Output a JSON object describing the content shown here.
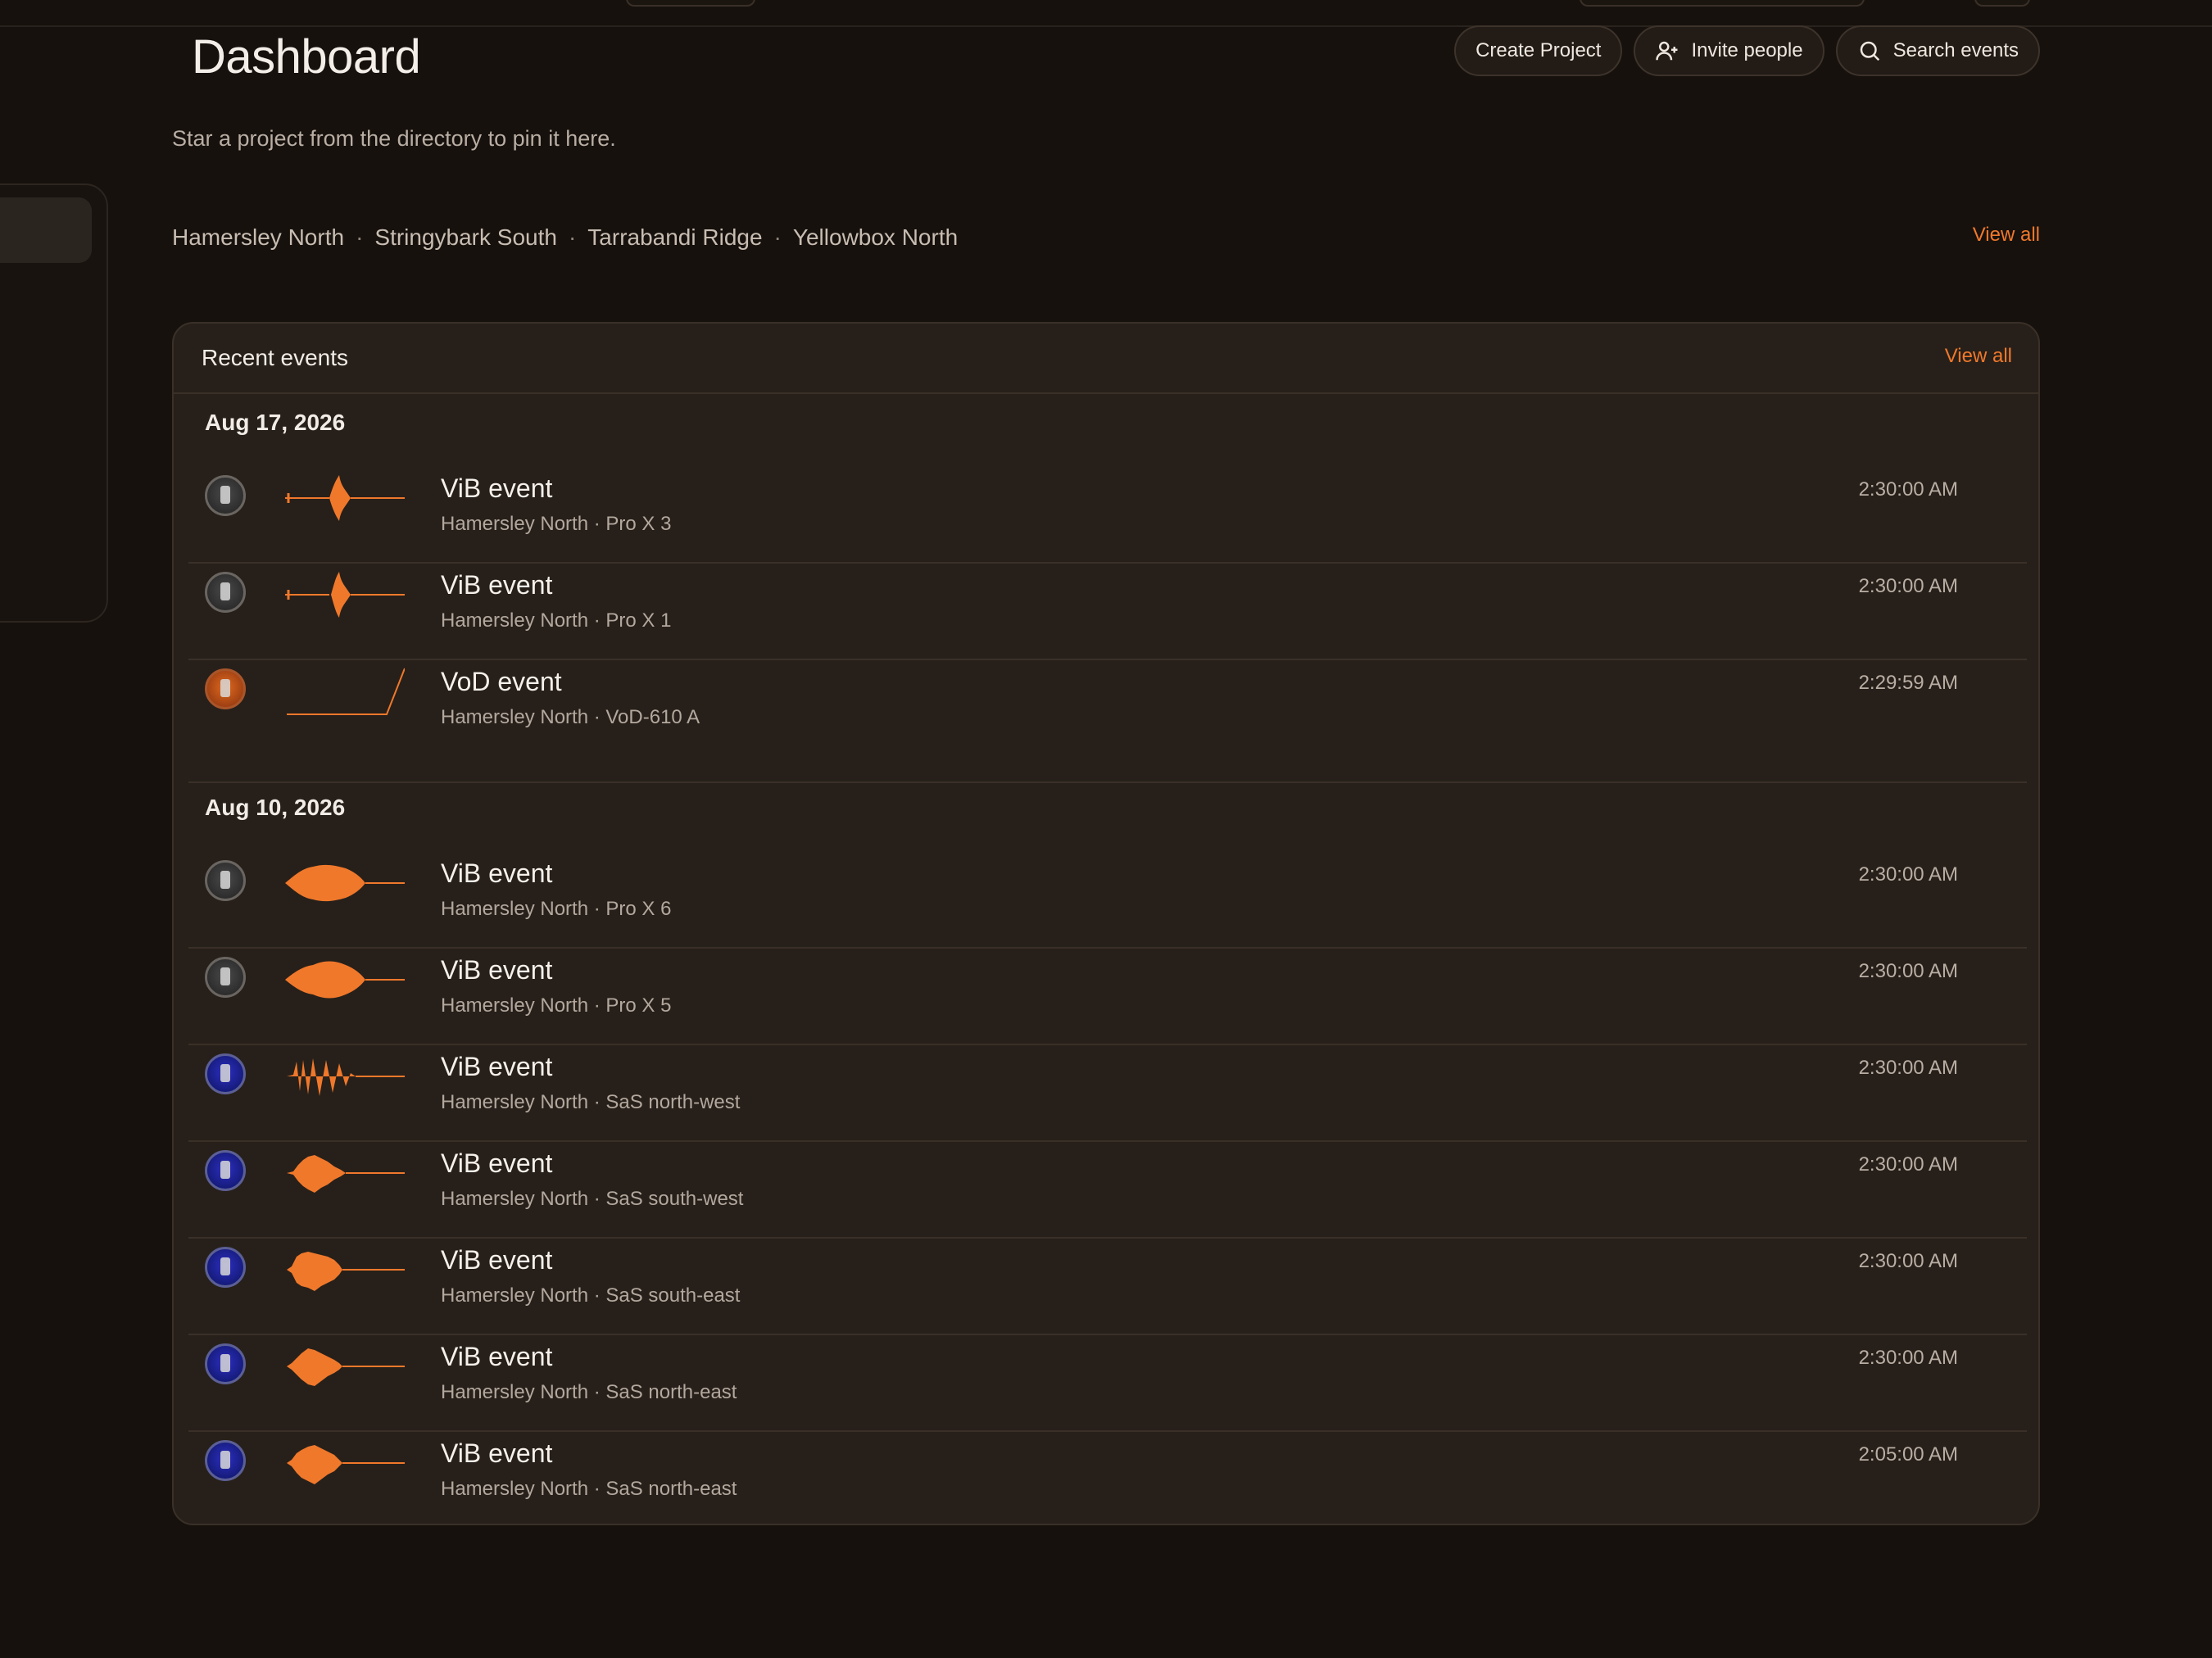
{
  "header": {
    "title": "Dashboard",
    "actions": [
      {
        "label": "Create Project",
        "icon": "none"
      },
      {
        "label": "Invite people",
        "icon": "user-plus-icon"
      },
      {
        "label": "Search events",
        "icon": "search-icon"
      }
    ]
  },
  "pinned": {
    "hint": "Star a project from the directory to pin it here.",
    "projects": [
      "Hamersley North",
      "Stringybark South",
      "Tarrabandi Ridge",
      "Yellowbox North"
    ],
    "separator": "·",
    "view_all": "View all"
  },
  "recent_events": {
    "title": "Recent events",
    "view_all": "View all",
    "groups": [
      {
        "date": "Aug 17, 2026",
        "events": [
          {
            "title": "ViB event",
            "subtitle": "Hamersley North · Pro X 3",
            "time": "2:30:00 AM",
            "device": "grey"
          },
          {
            "title": "ViB event",
            "subtitle": "Hamersley North · Pro X 1",
            "time": "2:30:00 AM",
            "device": "grey"
          },
          {
            "title": "VoD event",
            "subtitle": "Hamersley North · VoD-610 A",
            "time": "2:29:59 AM",
            "device": "orange"
          }
        ]
      },
      {
        "date": "Aug 10, 2026",
        "events": [
          {
            "title": "ViB event",
            "subtitle": "Hamersley North · Pro X 6",
            "time": "2:30:00 AM",
            "device": "grey"
          },
          {
            "title": "ViB event",
            "subtitle": "Hamersley North · Pro X 5",
            "time": "2:30:00 AM",
            "device": "grey"
          },
          {
            "title": "ViB event",
            "subtitle": "Hamersley North · SaS north-west",
            "time": "2:30:00 AM",
            "device": "blue"
          },
          {
            "title": "ViB event",
            "subtitle": "Hamersley North · SaS south-west",
            "time": "2:30:00 AM",
            "device": "blue"
          },
          {
            "title": "ViB event",
            "subtitle": "Hamersley North · SaS south-east",
            "time": "2:30:00 AM",
            "device": "blue"
          },
          {
            "title": "ViB event",
            "subtitle": "Hamersley North · SaS north-east",
            "time": "2:30:00 AM",
            "device": "blue"
          },
          {
            "title": "ViB event",
            "subtitle": "Hamersley North · SaS north-east",
            "time": "2:05:00 AM",
            "device": "blue"
          }
        ]
      }
    ]
  },
  "colors": {
    "accent": "#f0782b",
    "background": "#16110d",
    "card": "#27201a"
  }
}
